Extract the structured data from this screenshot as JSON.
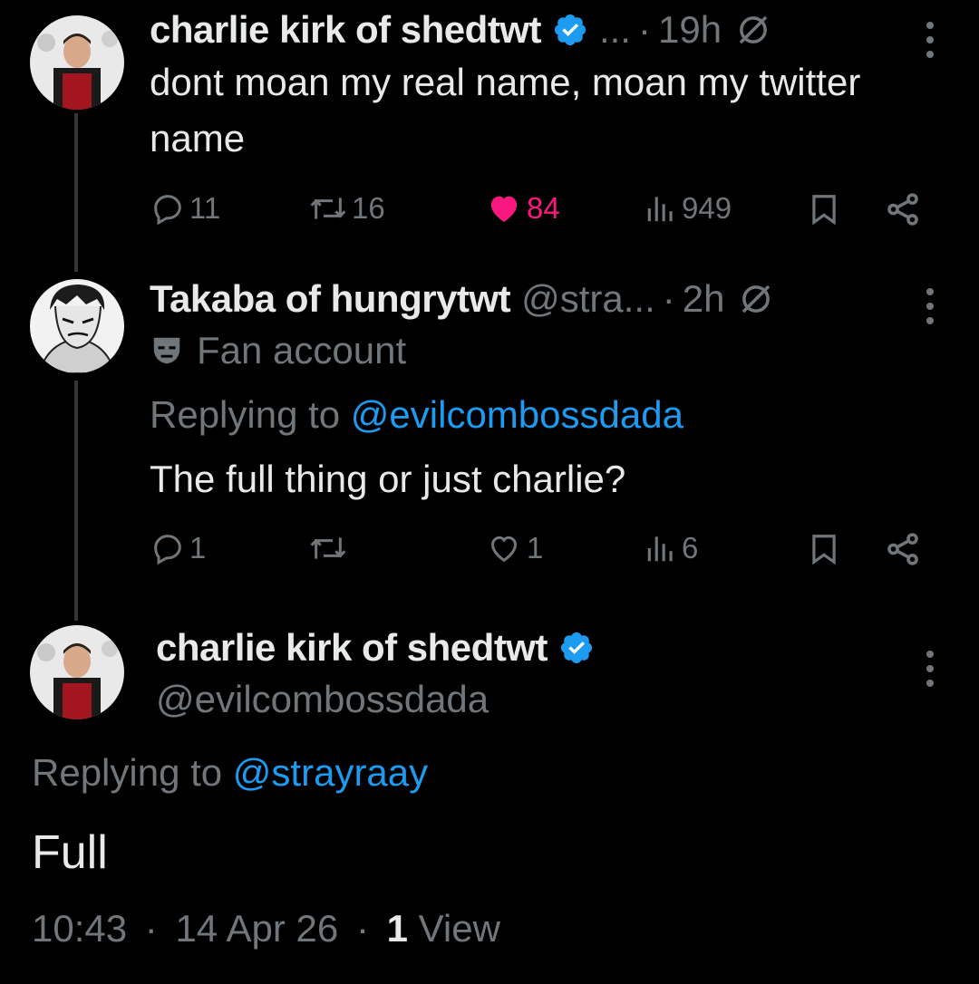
{
  "tweets": [
    {
      "display_name": "charlie kirk of shedtwt",
      "verified": true,
      "handle_truncated": "...",
      "time": "19h",
      "text": "dont moan my real name, moan my twitter name",
      "actions": {
        "replies": "11",
        "retweets": "16",
        "likes": "84",
        "liked": true,
        "views": "949"
      }
    },
    {
      "display_name": "Takaba of hungrytwt",
      "handle_truncated": "@stra...",
      "time": "2h",
      "badge_label": "Fan account",
      "reply_prefix": "Replying to",
      "reply_mention": "@evilcombossdada",
      "text": "The full thing or just charlie?",
      "actions": {
        "replies": "1",
        "retweets": "",
        "likes": "1",
        "liked": false,
        "views": "6"
      }
    }
  ],
  "focused_tweet": {
    "display_name": "charlie kirk of shedtwt",
    "verified": true,
    "handle": "@evilcombossdada",
    "reply_prefix": "Replying to",
    "reply_mention": "@strayraay",
    "text": "Full",
    "time": "10:43",
    "date": "14 Apr 26",
    "views_count": "1",
    "views_label": "View"
  },
  "colors": {
    "background": "#000000",
    "primary_text": "#e7e9ea",
    "secondary_text": "#71767b",
    "link": "#1d9bf0",
    "like": "#f91880",
    "verified": "#1d9bf0",
    "thread_line": "#333639"
  },
  "icons": [
    "reply-icon",
    "retweet-icon",
    "like-icon",
    "views-icon",
    "bookmark-icon",
    "share-icon",
    "verified-badge-icon",
    "grok-icon",
    "more-icon",
    "fan-mask-icon"
  ]
}
